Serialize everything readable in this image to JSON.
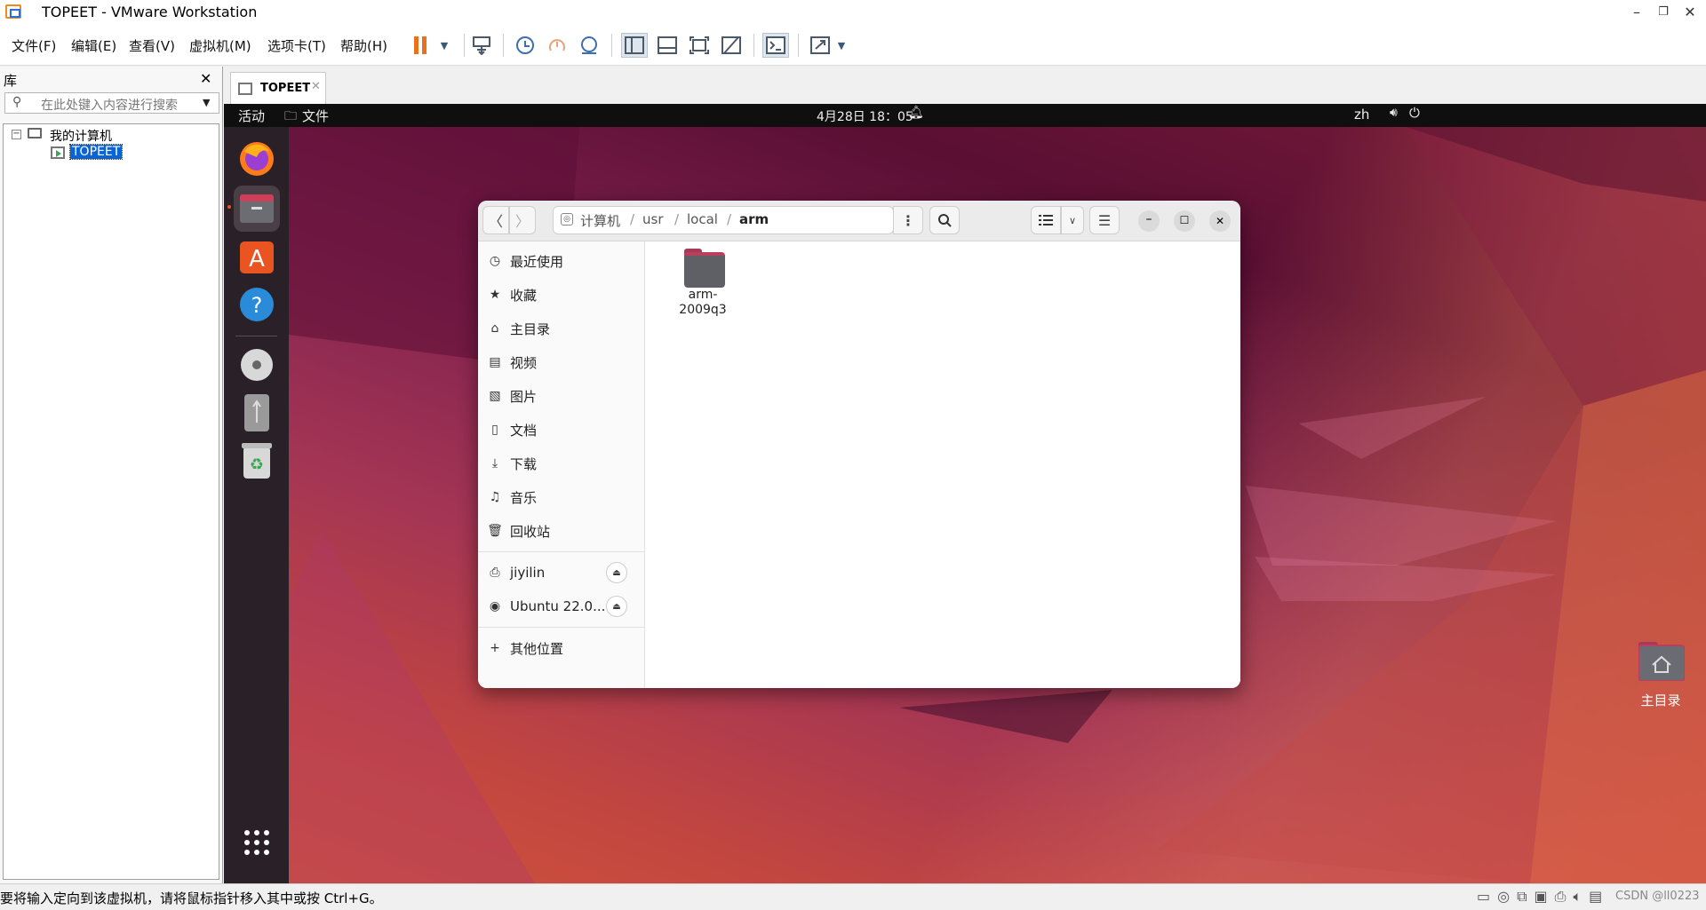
{
  "window": {
    "title": "TOPEET - VMware Workstation",
    "minimize": "–",
    "restore": "❐",
    "close": "✕"
  },
  "menu": [
    "文件(F)",
    "编辑(E)",
    "查看(V)",
    "虚拟机(M)",
    "选项卡(T)",
    "帮助(H)"
  ],
  "library": {
    "title": "库",
    "close": "✕",
    "search_placeholder": "在此处键入内容进行搜索",
    "tree": {
      "root": "我的计算机",
      "child": "TOPEET"
    }
  },
  "vm_tab": {
    "label": "TOPEET",
    "close": "✕"
  },
  "guest": {
    "topbar": {
      "activities": "活动",
      "app": "文件",
      "clock": "4月28日 18：05",
      "lang": "zh"
    },
    "filemanager": {
      "path": [
        "计算机",
        "usr",
        "local",
        "arm"
      ],
      "sidebar": [
        "最近使用",
        "收藏",
        "主目录",
        "视频",
        "图片",
        "文档",
        "下载",
        "音乐",
        "回收站"
      ],
      "devices": [
        "jiyilin",
        "Ubuntu 22.0..."
      ],
      "other": "其他位置",
      "files": [
        {
          "name": "arm-\n2009q3"
        }
      ]
    },
    "desktop_icon": "主目录"
  },
  "statusbar": {
    "hint": "要将输入定向到该虚拟机，请将鼠标指针移入其中或按 Ctrl+G。",
    "watermark": "CSDN @ll0223"
  }
}
